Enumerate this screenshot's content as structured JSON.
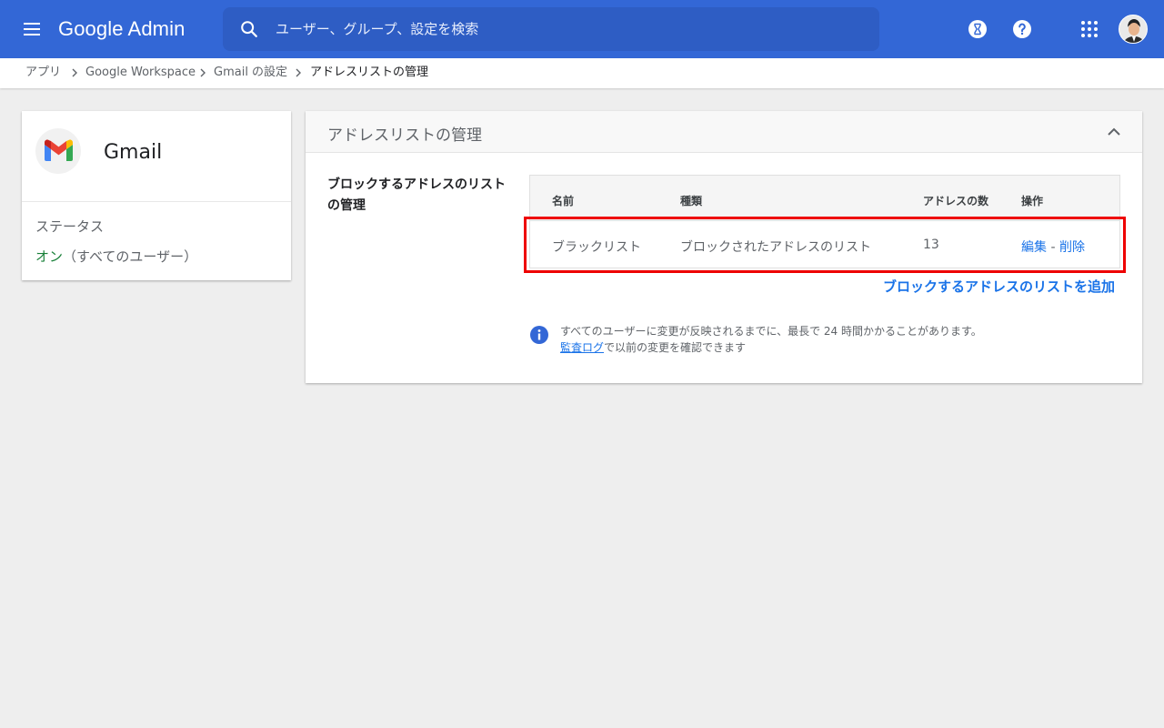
{
  "header": {
    "logo_text": "Google Admin",
    "search_placeholder": "ユーザー、グループ、設定を検索",
    "brand_color": "#3367d6"
  },
  "icons": {
    "menu": "menu-icon",
    "search": "search-icon",
    "hourglass": "hourglass-icon",
    "help": "help-icon",
    "apps": "apps-grid-icon",
    "avatar": "avatar",
    "gmail": "gmail-logo-icon",
    "collapse": "chevron-up-icon",
    "info": "info-icon"
  },
  "breadcrumb": {
    "items": [
      "アプリ",
      "Google Workspace",
      "Gmail の設定"
    ],
    "current": "アドレスリストの管理"
  },
  "sidebar_card": {
    "app_name": "Gmail",
    "status_label": "ステータス",
    "status_on": "オン",
    "status_scope": "（すべてのユーザー）",
    "status_color": "#188038"
  },
  "main_card": {
    "title": "アドレスリストの管理",
    "section_label": "ブロックするアドレスのリストの管理",
    "table": {
      "columns": [
        "名前",
        "種類",
        "アドレスの数",
        "操作"
      ],
      "rows": [
        {
          "name": "ブラックリスト",
          "type": "ブロックされたアドレスのリスト",
          "count": "13",
          "action_edit": "編集",
          "action_sep": "-",
          "action_delete": "削除"
        }
      ]
    },
    "add_link": "ブロックするアドレスのリストを追加",
    "info_line1": "すべてのユーザーに変更が反映されるまでに、最長で 24 時間かかることがあります。",
    "info_audit_link": "監査ログ",
    "info_line2_rest": "で以前の変更を確認できます",
    "highlight_color": "#ee0000",
    "link_color": "#1a73e8"
  }
}
